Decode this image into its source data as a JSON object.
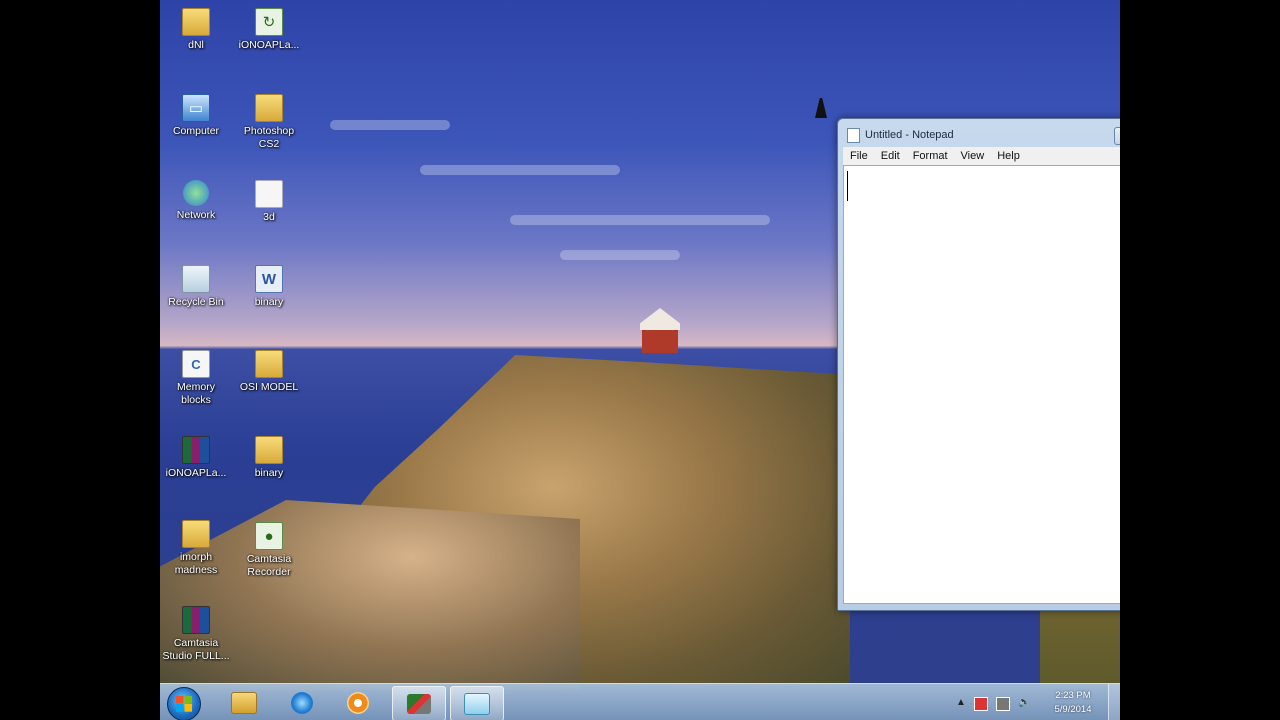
{
  "desktop": {
    "icons": [
      {
        "label": "dNl",
        "type": "folder"
      },
      {
        "label": "iONOAPLa...",
        "type": "app"
      },
      {
        "label": "Computer",
        "type": "pc"
      },
      {
        "label": "Photoshop\nCS2",
        "type": "folder"
      },
      {
        "label": "Network",
        "type": "net"
      },
      {
        "label": "3d",
        "type": "doc"
      },
      {
        "label": "Recycle Bin",
        "type": "bin"
      },
      {
        "label": "binary",
        "type": "word"
      },
      {
        "label": "Memory\nblocks",
        "type": "cdoc"
      },
      {
        "label": "OSI MODEL",
        "type": "folder"
      },
      {
        "label": "iONOAPLa...",
        "type": "rar"
      },
      {
        "label": "binary",
        "type": "folder"
      },
      {
        "label": "imorph\nmadness",
        "type": "folder"
      },
      {
        "label": "Camtasia\nRecorder",
        "type": "app"
      },
      {
        "label": "Camtasia\nStudio FULL...",
        "type": "rar"
      }
    ]
  },
  "notepad": {
    "title": "Untitled - Notepad",
    "menu": [
      "File",
      "Edit",
      "Format",
      "View",
      "Help"
    ],
    "content": "",
    "min_glyph": "▭",
    "max_glyph": "▭",
    "close_glyph": "✕",
    "scroll_up": "▲",
    "scroll_down": "▼"
  },
  "taskbar": {
    "apps": [
      "Windows Explorer",
      "Internet Explorer",
      "Windows Media Player",
      "Camtasia Recorder",
      "Notepad"
    ],
    "tray": {
      "show_hidden": "▲",
      "volume": "🔈"
    },
    "clock": {
      "time": "2:23 PM",
      "date": "5/9/2014"
    }
  }
}
